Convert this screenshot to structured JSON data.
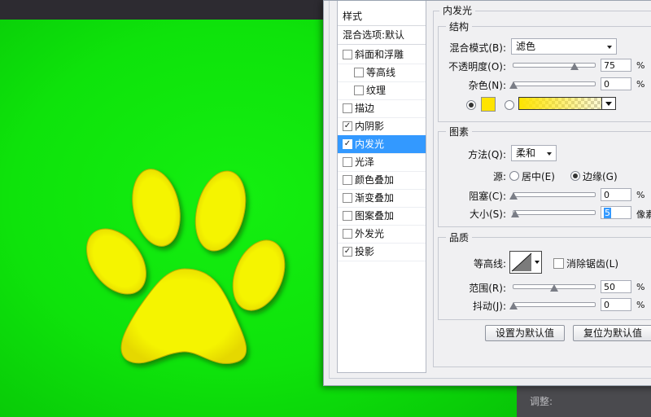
{
  "colors": {
    "canvas_green": "#0ee30b",
    "paw_yellow": "#f5f400",
    "selection_blue": "#3399ff",
    "glow_swatch": "#ffe400"
  },
  "photoshop": {
    "adjust_panel_label": "调整:"
  },
  "canvas": {
    "content": "yellow-paw-print"
  },
  "layer_style": {
    "styles_header": "样式",
    "blend_options_header": "混合选项:默认",
    "effects": [
      {
        "label": "斜面和浮雕",
        "checked": false,
        "selected": false
      },
      {
        "label": "等高线",
        "checked": false,
        "selected": false
      },
      {
        "label": "纹理",
        "checked": false,
        "selected": false
      },
      {
        "label": "描边",
        "checked": false,
        "selected": false
      },
      {
        "label": "内阴影",
        "checked": true,
        "selected": false
      },
      {
        "label": "内发光",
        "checked": true,
        "selected": true
      },
      {
        "label": "光泽",
        "checked": false,
        "selected": false
      },
      {
        "label": "颜色叠加",
        "checked": false,
        "selected": false
      },
      {
        "label": "渐变叠加",
        "checked": false,
        "selected": false
      },
      {
        "label": "图案叠加",
        "checked": false,
        "selected": false
      },
      {
        "label": "外发光",
        "checked": false,
        "selected": false
      },
      {
        "label": "投影",
        "checked": true,
        "selected": false
      }
    ],
    "panel_title": "内发光",
    "structure": {
      "title": "结构",
      "blend_mode_label": "混合模式(B):",
      "blend_mode_value": "滤色",
      "opacity_label": "不透明度(O):",
      "opacity_value": "75",
      "opacity_unit": "%",
      "opacity_level": 0.75,
      "noise_label": "杂色(N):",
      "noise_value": "0",
      "noise_unit": "%",
      "noise_level": 0.0
    },
    "elements": {
      "title": "图素",
      "method_label": "方法(Q):",
      "method_value": "柔和",
      "source_label": "源:",
      "source_center_label": "居中(E)",
      "source_edge_label": "边缘(G)",
      "choke_label": "阻塞(C):",
      "choke_value": "0",
      "choke_unit": "%",
      "choke_level": 0.0,
      "size_label": "大小(S):",
      "size_value": "5",
      "size_unit": "像素",
      "size_level": 0.02
    },
    "quality": {
      "title": "品质",
      "contour_label": "等高线:",
      "antialias_label": "消除锯齿(L)",
      "range_label": "范围(R):",
      "range_value": "50",
      "range_unit": "%",
      "range_level": 0.5,
      "jitter_label": "抖动(J):",
      "jitter_value": "0",
      "jitter_unit": "%",
      "jitter_level": 0.0
    },
    "buttons": {
      "set_default": "设置为默认值",
      "reset_default": "复位为默认值"
    }
  }
}
